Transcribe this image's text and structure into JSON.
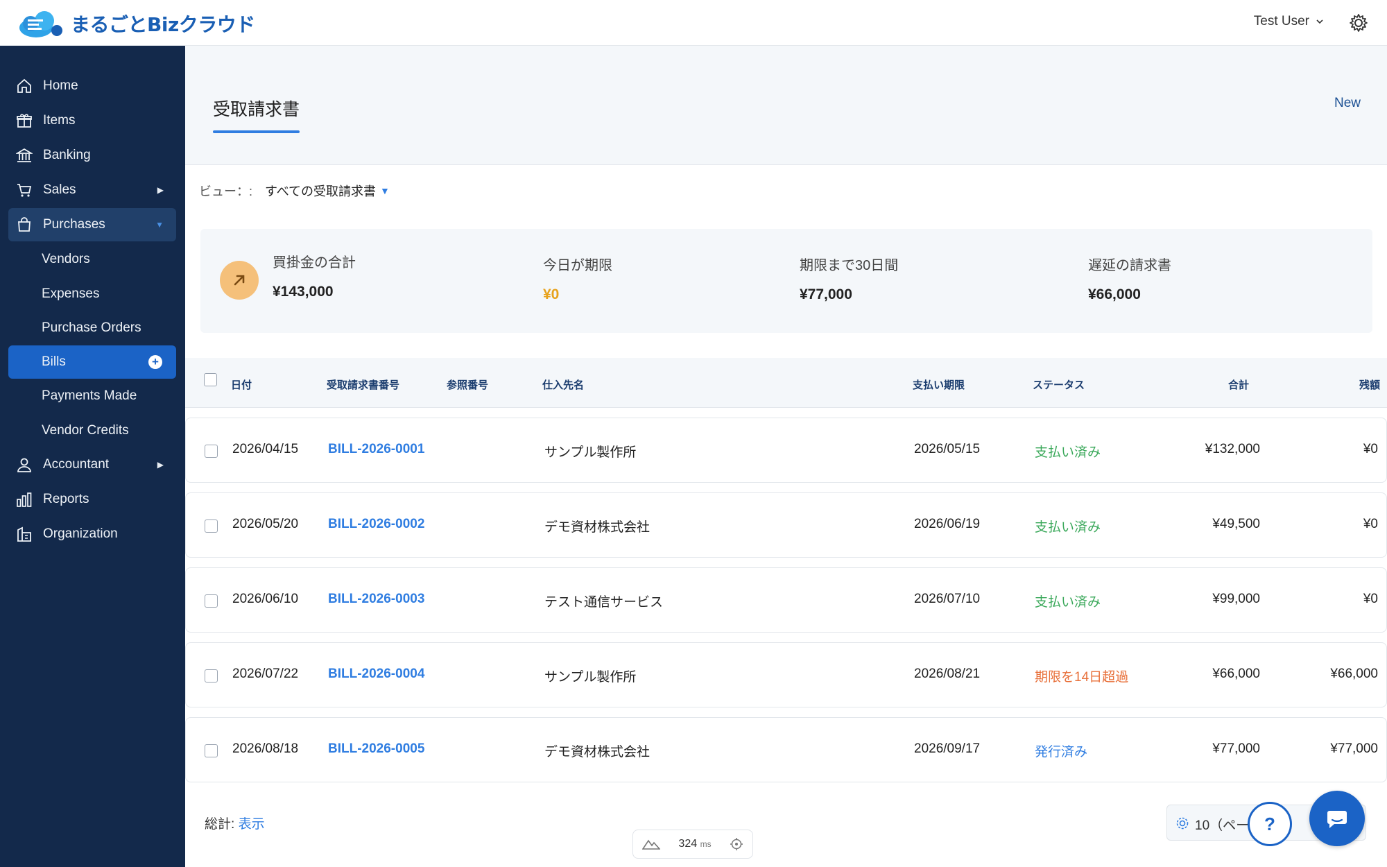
{
  "app": {
    "logo_text": "まるごとBizクラウド"
  },
  "header": {
    "user_name": "Test User"
  },
  "sidebar": {
    "items": [
      {
        "label": "Home",
        "icon": "home-icon"
      },
      {
        "label": "Items",
        "icon": "gift-icon"
      },
      {
        "label": "Banking",
        "icon": "bank-icon"
      },
      {
        "label": "Sales",
        "icon": "cart-icon"
      },
      {
        "label": "Purchases",
        "icon": "bag-icon"
      },
      {
        "label": "Vendors"
      },
      {
        "label": "Expenses"
      },
      {
        "label": "Purchase Orders"
      },
      {
        "label": "Bills"
      },
      {
        "label": "Payments Made"
      },
      {
        "label": "Vendor Credits"
      },
      {
        "label": "Accountant",
        "icon": "user-icon"
      },
      {
        "label": "Reports",
        "icon": "bar-chart-icon"
      },
      {
        "label": "Organization",
        "icon": "building-icon"
      }
    ]
  },
  "page": {
    "title": "受取請求書",
    "new_label": "New"
  },
  "view": {
    "label": "ビュー：:",
    "value": "すべての受取請求書"
  },
  "summary": {
    "total_label": "買掛金の合計",
    "total_value": "¥143,000",
    "today_label": "今日が期限",
    "today_value": "¥0",
    "d30_label": "期限まで30日間",
    "d30_value": "¥77,000",
    "overdue_label": "遅延の請求書",
    "overdue_value": "¥66,000"
  },
  "table": {
    "headers": {
      "date": "日付",
      "bill_no": "受取請求書番号",
      "ref": "参照番号",
      "vendor": "仕入先名",
      "due": "支払い期限",
      "status": "ステータス",
      "total": "合計",
      "balance": "残額"
    },
    "rows": [
      {
        "date": "2026/04/15",
        "bill_no": "BILL-2026-0001",
        "vendor": "サンプル製作所",
        "due": "2026/05/15",
        "status": "支払い済み",
        "total": "¥132,000",
        "balance": "¥0"
      },
      {
        "date": "2026/05/20",
        "bill_no": "BILL-2026-0002",
        "vendor": "デモ資材株式会社",
        "due": "2026/06/19",
        "status": "支払い済み",
        "total": "¥49,500",
        "balance": "¥0"
      },
      {
        "date": "2026/06/10",
        "bill_no": "BILL-2026-0003",
        "vendor": "テスト通信サービス",
        "due": "2026/07/10",
        "status": "支払い済み",
        "total": "¥99,000",
        "balance": "¥0"
      },
      {
        "date": "2026/07/22",
        "bill_no": "BILL-2026-0004",
        "vendor": "サンプル製作所",
        "due": "2026/08/21",
        "status": "期限を14日超過",
        "total": "¥66,000",
        "balance": "¥66,000"
      },
      {
        "date": "2026/08/18",
        "bill_no": "BILL-2026-0005",
        "vendor": "デモ資材株式会社",
        "due": "2026/09/17",
        "status": "発行済み",
        "total": "¥77,000",
        "balance": "¥77,000"
      }
    ]
  },
  "footer": {
    "total_label": "総計:",
    "show_label": "表示",
    "per_page": "10（ペー",
    "perf_value": "324",
    "perf_unit": "ms"
  },
  "colors": {
    "sidebar_bg": "#13294b",
    "accent": "#1b63c6",
    "paid": "#3aa85a",
    "overdue": "#e8703a"
  }
}
